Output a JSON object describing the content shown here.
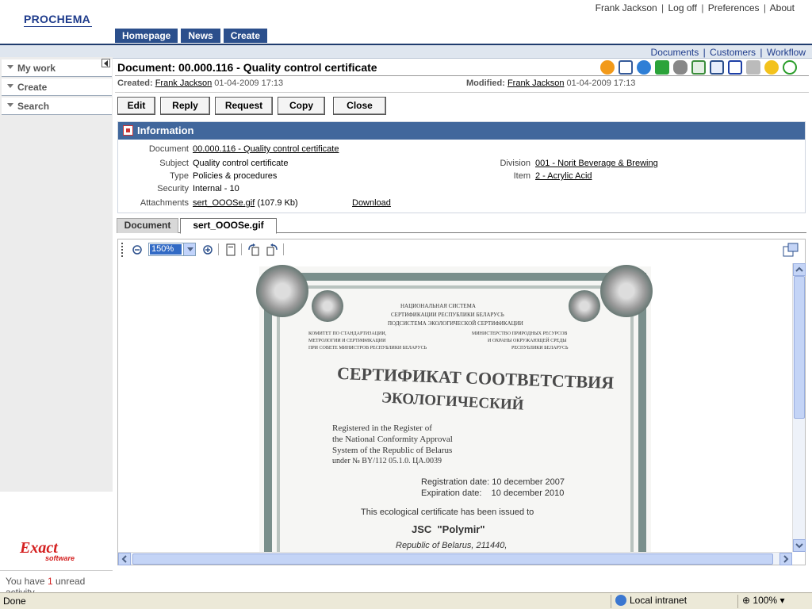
{
  "header": {
    "logo": "PROCHEMA",
    "user_name": "Frank Jackson",
    "links": [
      "Log off",
      "Preferences",
      "About"
    ],
    "nav": [
      "Homepage",
      "News",
      "Create"
    ],
    "sub_links": [
      "Documents",
      "Customers",
      "Workflow"
    ]
  },
  "sidebar": {
    "items": [
      "My work",
      "Create",
      "Search"
    ],
    "logo_big": "Exact",
    "logo_small": "software",
    "unread_prefix": "You have",
    "unread_count": "1",
    "unread_suffix": "unread activity"
  },
  "document": {
    "title": "Document: 00.000.116 - Quality control certificate",
    "created_label": "Created:",
    "created_by": "Frank Jackson",
    "created_at": "01-04-2009 17:13",
    "modified_label": "Modified:",
    "modified_by": "Frank Jackson",
    "modified_at": "01-04-2009 17:13",
    "toolbar_icons": [
      "go-arrow-icon",
      "calendar-icon",
      "refresh-icon",
      "info-icon",
      "database-icon",
      "checklist-icon",
      "copy-window-icon",
      "word-icon",
      "print-icon",
      "favorite-star-icon",
      "help-icon"
    ]
  },
  "actions": [
    "Edit",
    "Reply",
    "Request",
    "Copy",
    "Close"
  ],
  "info": {
    "header": "Information",
    "document_label": "Document",
    "document_value": "00.000.116 - Quality control certificate",
    "subject_label": "Subject",
    "subject_value": "Quality control certificate",
    "type_label": "Type",
    "type_value": "Policies & procedures",
    "security_label": "Security",
    "security_value": "Internal - 10",
    "attachments_label": "Attachments",
    "attachment_file": "sert_OOOSe.gif",
    "attachment_size": "(107.9 Kb)",
    "download_label": "Download",
    "division_label": "Division",
    "division_value": "001 - Norit Beverage & Brewing",
    "item_label": "Item",
    "item_value": "2 - Acrylic Acid"
  },
  "tabs": [
    "Document",
    "sert_OOOSe.gif"
  ],
  "viewer": {
    "zoom": "150%"
  },
  "certificate": {
    "header_lines": [
      "НАЦИОНАЛЬНАЯ СИСТЕМА",
      "СЕРТИФИКАЦИИ РЕСПУБЛИКИ БЕЛАРУСЬ",
      "ПОДСИСТЕМА ЭКОЛОГИЧЕСКОЙ СЕРТИФИКАЦИИ"
    ],
    "left_lines": [
      "КОМИТЕТ ПО СТАНДАРТИЗАЦИИ,",
      "МЕТРОЛОГИИ И СЕРТИФИКАЦИИ",
      "ПРИ СОВЕТЕ МИНИСТРОВ РЕСПУБЛИКИ БЕЛАРУСЬ"
    ],
    "right_lines": [
      "МИНИСТЕРСТВО ПРИРОДНЫХ РЕСУРСОВ",
      "И ОХРАНЫ ОКРУЖАЮЩЕЙ СРЕДЫ",
      "РЕСПУБЛИКИ БЕЛАРУСЬ"
    ],
    "title1": "СЕРТИФИКАТ СООТВЕТСТВИЯ",
    "title2": "ЭКОЛОГИЧЕСКИЙ",
    "reg_lines": [
      "Registered in the Register of",
      "the National Conformity Approval",
      "System of the Republic of Belarus",
      "under № BY/112 05.1.0. ЦА.0039"
    ],
    "registration": "Registration date: 10 december 2007",
    "expiration": "Expiration date:    10 december 2010",
    "issued": "This ecological certificate has been issued to",
    "company": "JSC  \"Polymir\"",
    "address": "Republic of Belarus, 211440,"
  },
  "statusbar": {
    "status": "Done",
    "zone": "Local intranet",
    "zoom": "100%"
  },
  "colors": {
    "nav_blue": "#2b4f8c",
    "info_header": "#41679c",
    "logo_blue": "#1f3c8c",
    "exact_red": "#d42020"
  }
}
